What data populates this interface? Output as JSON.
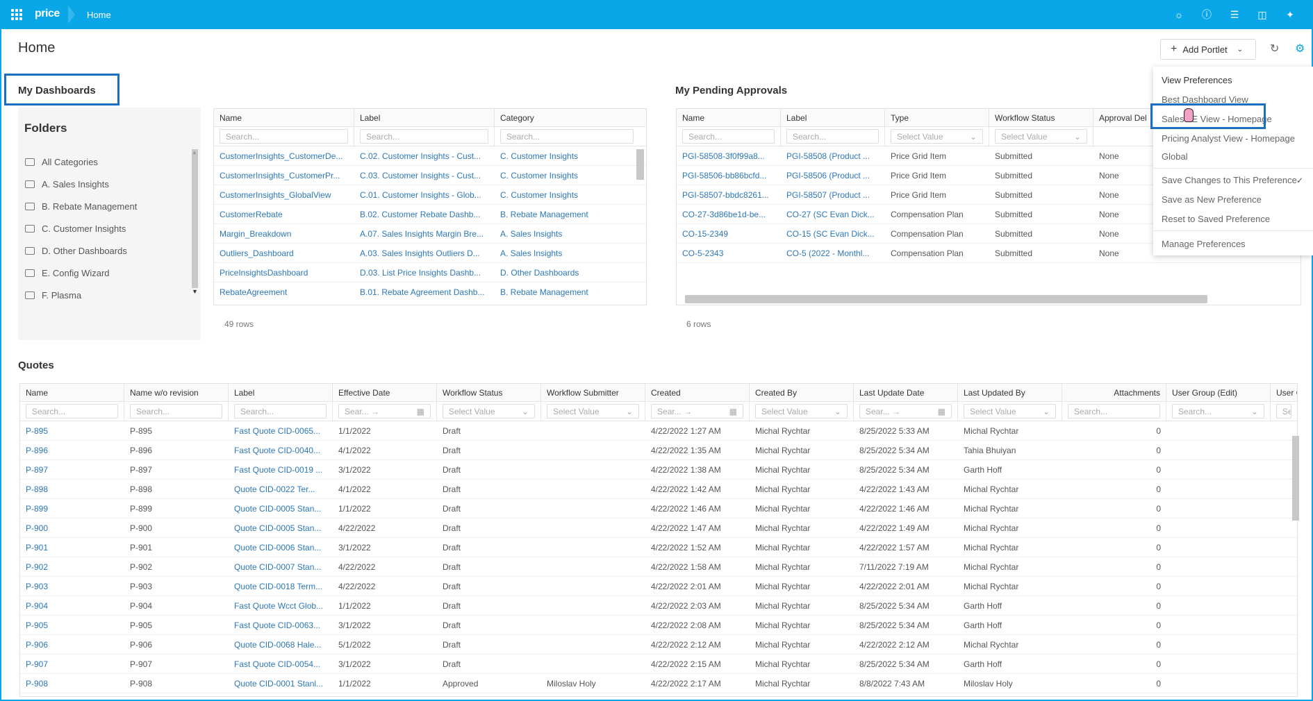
{
  "topbar": {
    "logo": "price",
    "crumb": "Home"
  },
  "page": {
    "title": "Home",
    "add_portlet": "Add Portlet"
  },
  "dashboards": {
    "title": "My Dashboards",
    "folders_title": "Folders",
    "folders": [
      "All Categories",
      "A. Sales Insights",
      "B. Rebate Management",
      "C. Customer Insights",
      "D. Other Dashboards",
      "E. Config Wizard",
      "F. Plasma"
    ],
    "columns": [
      "Name",
      "Label",
      "Category"
    ],
    "search_placeholder": "Search...",
    "rows": [
      [
        "CustomerInsights_CustomerDe...",
        "C.02. Customer Insights - Cust...",
        "C. Customer Insights"
      ],
      [
        "CustomerInsights_CustomerPr...",
        "C.03. Customer Insights - Cust...",
        "C. Customer Insights"
      ],
      [
        "CustomerInsights_GlobalView",
        "C.01. Customer Insights - Glob...",
        "C. Customer Insights"
      ],
      [
        "CustomerRebate",
        "B.02. Customer Rebate Dashb...",
        "B. Rebate Management"
      ],
      [
        "Margin_Breakdown",
        "A.07. Sales Insights Margin Bre...",
        "A. Sales Insights"
      ],
      [
        "Outliers_Dashboard",
        "A.03. Sales Insights Outliers D...",
        "A. Sales Insights"
      ],
      [
        "PriceInsightsDashboard",
        "D.03. List Price Insights Dashb...",
        "D. Other Dashboards"
      ],
      [
        "RebateAgreement",
        "B.01. Rebate Agreement Dashb...",
        "B. Rebate Management"
      ]
    ],
    "row_count": "49 rows"
  },
  "approvals": {
    "title": "My Pending Approvals",
    "columns": [
      "Name",
      "Label",
      "Type",
      "Workflow Status",
      "Approval Del"
    ],
    "filters": [
      "Search...",
      "Search...",
      "Select Value",
      "Select Value"
    ],
    "rows": [
      [
        "PGI-58508-3f0f99a8...",
        "PGI-58508 (Product ...",
        "Price Grid Item",
        "Submitted",
        "None"
      ],
      [
        "PGI-58506-bb86bcfd...",
        "PGI-58506 (Product ...",
        "Price Grid Item",
        "Submitted",
        "None"
      ],
      [
        "PGI-58507-bbdc8261...",
        "PGI-58507 (Product ...",
        "Price Grid Item",
        "Submitted",
        "None"
      ],
      [
        "CO-27-3d86be1d-be...",
        "CO-27 (SC Evan Dick...",
        "Compensation Plan",
        "Submitted",
        "None"
      ],
      [
        "CO-15-2349",
        "CO-15 (SC Evan Dick...",
        "Compensation Plan",
        "Submitted",
        "None"
      ],
      [
        "CO-5-2343",
        "CO-5 (2022 - Monthl...",
        "Compensation Plan",
        "Submitted",
        "None"
      ]
    ],
    "row_count": "6 rows"
  },
  "preferences": {
    "view_preferences": "View Preferences",
    "views": [
      "Best Dashboard View",
      "Sales LE View - Homepage",
      "Pricing Analyst View - Homepage",
      "Global"
    ],
    "actions": [
      "Save Changes to This Preference",
      "Save as New Preference",
      "Reset to Saved Preference"
    ],
    "manage": "Manage Preferences",
    "check": "✓"
  },
  "quotes": {
    "title": "Quotes",
    "columns": [
      "Name",
      "Name w/o revision",
      "Label",
      "Effective Date",
      "Workflow Status",
      "Workflow Submitter",
      "Created",
      "Created By",
      "Last Update Date",
      "Last Updated By",
      "Attachments",
      "User Group (Edit)",
      "User Gr"
    ],
    "filters": [
      "Search...",
      "Search...",
      "Search...",
      "Sear... →",
      "Select Value",
      "Select Value",
      "Sear... →",
      "Select Value",
      "Sear... →",
      "Select Value",
      "Search...",
      "Search...",
      "Searc"
    ],
    "rows": [
      [
        "P-895",
        "P-895",
        "Fast Quote CID-0065...",
        "1/1/2022",
        "Draft",
        "",
        "4/22/2022 1:27 AM",
        "Michal Rychtar",
        "8/25/2022 5:33 AM",
        "Michal Rychtar",
        "0"
      ],
      [
        "P-896",
        "P-896",
        "Fast Quote CID-0040...",
        "4/1/2022",
        "Draft",
        "",
        "4/22/2022 1:35 AM",
        "Michal Rychtar",
        "8/25/2022 5:34 AM",
        "Tahia Bhuiyan",
        "0"
      ],
      [
        "P-897",
        "P-897",
        "Fast Quote CID-0019 ...",
        "3/1/2022",
        "Draft",
        "",
        "4/22/2022 1:38 AM",
        "Michal Rychtar",
        "8/25/2022 5:34 AM",
        "Garth Hoff",
        "0"
      ],
      [
        "P-898",
        "P-898",
        "Quote CID-0022 Ter...",
        "4/1/2022",
        "Draft",
        "",
        "4/22/2022 1:42 AM",
        "Michal Rychtar",
        "4/22/2022 1:43 AM",
        "Michal Rychtar",
        "0"
      ],
      [
        "P-899",
        "P-899",
        "Quote CID-0005 Stan...",
        "1/1/2022",
        "Draft",
        "",
        "4/22/2022 1:46 AM",
        "Michal Rychtar",
        "4/22/2022 1:46 AM",
        "Michal Rychtar",
        "0"
      ],
      [
        "P-900",
        "P-900",
        "Quote CID-0005 Stan...",
        "4/22/2022",
        "Draft",
        "",
        "4/22/2022 1:47 AM",
        "Michal Rychtar",
        "4/22/2022 1:49 AM",
        "Michal Rychtar",
        "0"
      ],
      [
        "P-901",
        "P-901",
        "Quote CID-0006 Stan...",
        "3/1/2022",
        "Draft",
        "",
        "4/22/2022 1:52 AM",
        "Michal Rychtar",
        "4/22/2022 1:57 AM",
        "Michal Rychtar",
        "0"
      ],
      [
        "P-902",
        "P-902",
        "Quote CID-0007 Stan...",
        "4/22/2022",
        "Draft",
        "",
        "4/22/2022 1:58 AM",
        "Michal Rychtar",
        "7/11/2022 7:19 AM",
        "Michal Rychtar",
        "0"
      ],
      [
        "P-903",
        "P-903",
        "Quote CID-0018 Term...",
        "4/22/2022",
        "Draft",
        "",
        "4/22/2022 2:01 AM",
        "Michal Rychtar",
        "4/22/2022 2:01 AM",
        "Michal Rychtar",
        "0"
      ],
      [
        "P-904",
        "P-904",
        "Fast Quote Wcct Glob...",
        "1/1/2022",
        "Draft",
        "",
        "4/22/2022 2:03 AM",
        "Michal Rychtar",
        "8/25/2022 5:34 AM",
        "Garth Hoff",
        "0"
      ],
      [
        "P-905",
        "P-905",
        "Fast Quote CID-0063...",
        "3/1/2022",
        "Draft",
        "",
        "4/22/2022 2:08 AM",
        "Michal Rychtar",
        "8/25/2022 5:34 AM",
        "Garth Hoff",
        "0"
      ],
      [
        "P-906",
        "P-906",
        "Quote CID-0068 Hale...",
        "5/1/2022",
        "Draft",
        "",
        "4/22/2022 2:12 AM",
        "Michal Rychtar",
        "4/22/2022 2:12 AM",
        "Michal Rychtar",
        "0"
      ],
      [
        "P-907",
        "P-907",
        "Fast Quote CID-0054...",
        "3/1/2022",
        "Draft",
        "",
        "4/22/2022 2:15 AM",
        "Michal Rychtar",
        "8/25/2022 5:34 AM",
        "Garth Hoff",
        "0"
      ],
      [
        "P-908",
        "P-908",
        "Quote CID-0001 Stanl...",
        "1/1/2022",
        "Approved",
        "Miloslav Holy",
        "4/22/2022 2:17 AM",
        "Michal Rychtar",
        "8/8/2022 7:43 AM",
        "Miloslav Holy",
        "0"
      ]
    ]
  },
  "colors": {
    "brand": "#0aa7e8",
    "link": "#2c77b8",
    "highlight": "#1a6fc2"
  }
}
